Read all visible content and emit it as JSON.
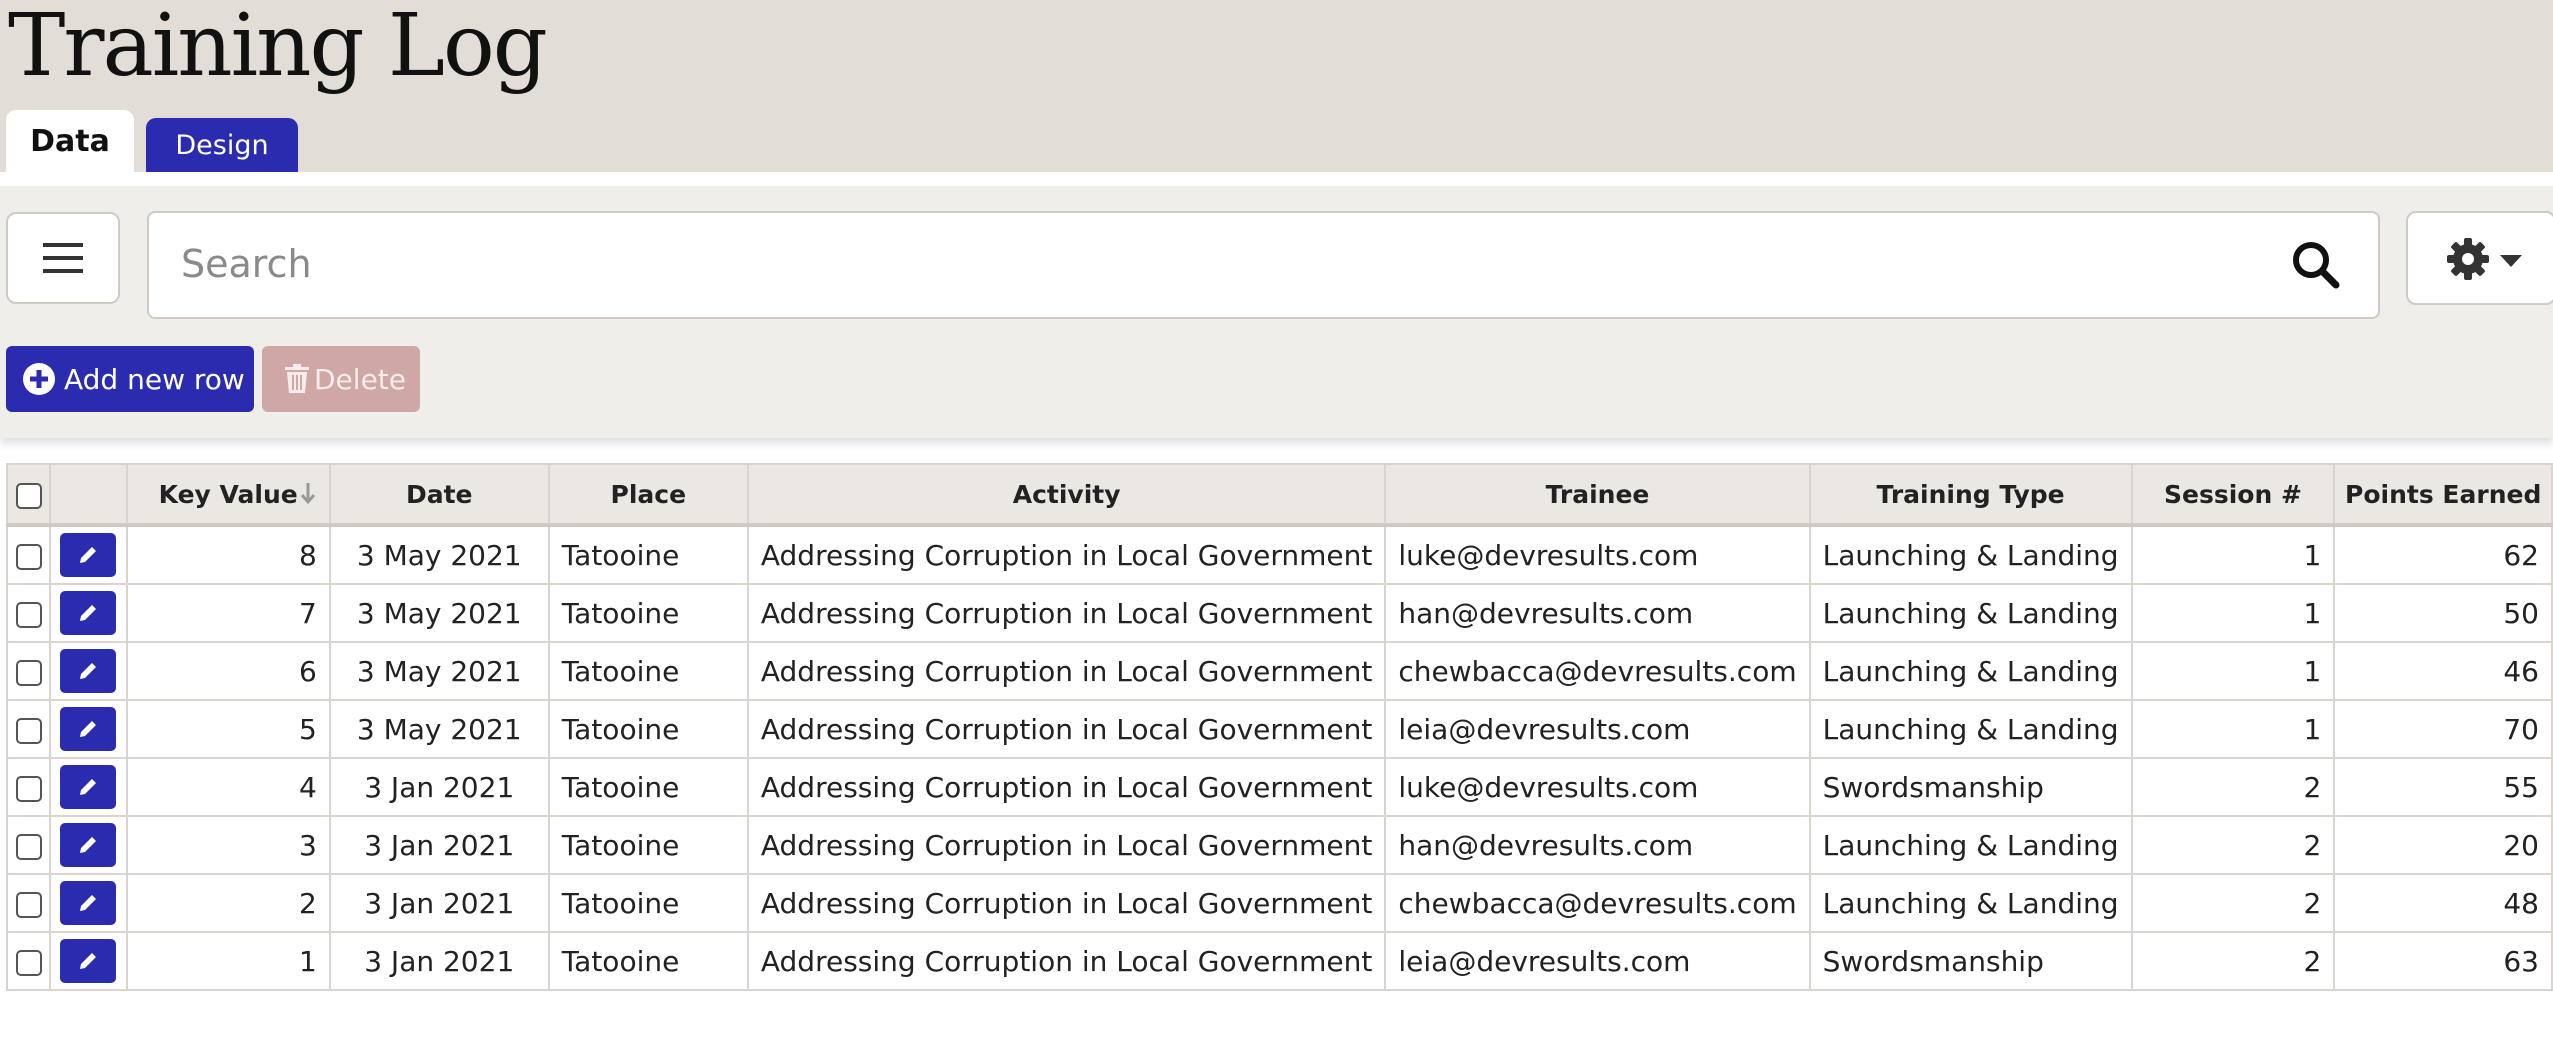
{
  "app": {
    "title": "Training Log",
    "tabs": [
      {
        "label": "Data",
        "active": true
      },
      {
        "label": "Design",
        "active": false
      }
    ]
  },
  "toolbar": {
    "menu_icon": "hamburger-menu-icon",
    "search": {
      "placeholder": "Search",
      "value": "",
      "icon": "search-icon"
    },
    "settings_icon": "gear-icon",
    "add_label": "Add new row",
    "delete_label": "Delete"
  },
  "colors": {
    "accent": "#2b2bb0",
    "header_bg": "#e2ddd7",
    "toolbar_bg": "#f0eeea",
    "delete_disabled": "#cfa8a6"
  },
  "table": {
    "columns": [
      "Key Value",
      "Date",
      "Place",
      "Activity",
      "Trainee",
      "Training Type",
      "Session #",
      "Points Earned"
    ],
    "sort": {
      "column": "Key Value",
      "direction": "descending"
    },
    "rows": [
      {
        "key": "8",
        "date": "3 May 2021",
        "place": "Tatooine",
        "activity": "Addressing Corruption in Local Government",
        "trainee": "luke@devresults.com",
        "type": "Launching & Landing",
        "session": "1",
        "points": "62"
      },
      {
        "key": "7",
        "date": "3 May 2021",
        "place": "Tatooine",
        "activity": "Addressing Corruption in Local Government",
        "trainee": "han@devresults.com",
        "type": "Launching & Landing",
        "session": "1",
        "points": "50"
      },
      {
        "key": "6",
        "date": "3 May 2021",
        "place": "Tatooine",
        "activity": "Addressing Corruption in Local Government",
        "trainee": "chewbacca@devresults.com",
        "type": "Launching & Landing",
        "session": "1",
        "points": "46"
      },
      {
        "key": "5",
        "date": "3 May 2021",
        "place": "Tatooine",
        "activity": "Addressing Corruption in Local Government",
        "trainee": "leia@devresults.com",
        "type": "Launching & Landing",
        "session": "1",
        "points": "70"
      },
      {
        "key": "4",
        "date": "3 Jan 2021",
        "place": "Tatooine",
        "activity": "Addressing Corruption in Local Government",
        "trainee": "luke@devresults.com",
        "type": "Swordsmanship",
        "session": "2",
        "points": "55"
      },
      {
        "key": "3",
        "date": "3 Jan 2021",
        "place": "Tatooine",
        "activity": "Addressing Corruption in Local Government",
        "trainee": "han@devresults.com",
        "type": "Launching & Landing",
        "session": "2",
        "points": "20"
      },
      {
        "key": "2",
        "date": "3 Jan 2021",
        "place": "Tatooine",
        "activity": "Addressing Corruption in Local Government",
        "trainee": "chewbacca@devresults.com",
        "type": "Launching & Landing",
        "session": "2",
        "points": "48"
      },
      {
        "key": "1",
        "date": "3 Jan 2021",
        "place": "Tatooine",
        "activity": "Addressing Corruption in Local Government",
        "trainee": "leia@devresults.com",
        "type": "Swordsmanship",
        "session": "2",
        "points": "63"
      }
    ]
  }
}
